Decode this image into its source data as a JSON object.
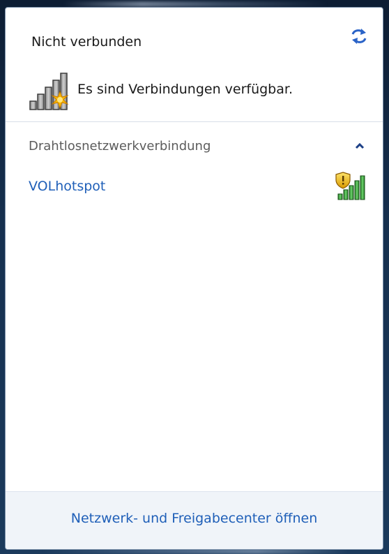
{
  "status": {
    "title": "Nicht verbunden",
    "message": "Es sind Verbindungen verfügbar.",
    "refresh_icon": "refresh-icon",
    "signal_icon": "signal-warning-icon"
  },
  "wireless": {
    "section_title": "Drahtlosnetzwerkverbindung",
    "collapse_icon": "chevron-up-icon",
    "networks": [
      {
        "name": "VOLhotspot",
        "icon": "secured-signal-icon",
        "signal_bars": 5,
        "secured": true
      }
    ]
  },
  "footer": {
    "link_label": "Netzwerk- und Freigabecenter öffnen"
  },
  "colors": {
    "link": "#1f5fb8",
    "signal_green": "#2e9a2e",
    "warning_yellow": "#f5c518",
    "footer_bg": "#f0f4f9"
  }
}
